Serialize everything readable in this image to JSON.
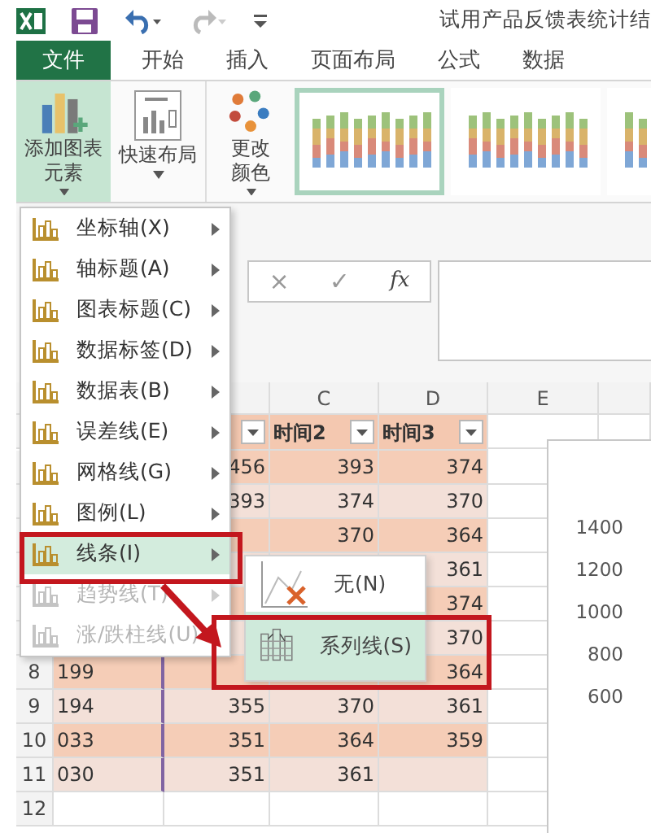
{
  "title_bar": {
    "title": "试用产品反馈表统计结"
  },
  "ribbon_tabs": [
    {
      "label": "文件",
      "kind": "file"
    },
    {
      "label": "开始",
      "kind": "tab"
    },
    {
      "label": "插入",
      "kind": "tab"
    },
    {
      "label": "页面布局",
      "kind": "tab"
    },
    {
      "label": "公式",
      "kind": "tab"
    },
    {
      "label": "数据",
      "kind": "tab"
    }
  ],
  "ribbon_buttons": [
    {
      "label": "添加图表元素",
      "kind": "add",
      "selected": true
    },
    {
      "label": "快速布局",
      "kind": "layout",
      "selected": false
    },
    {
      "label": "更改颜色",
      "kind": "colors",
      "selected": false
    }
  ],
  "chart_styles": [
    {
      "selected": true
    },
    {
      "selected": false
    },
    {
      "selected": false
    }
  ],
  "formula_bar": {
    "cancel": "×",
    "enter": "✓",
    "function": "fx"
  },
  "column_headers": [
    "C",
    "D",
    "E"
  ],
  "header_row": [
    {
      "filter": true
    },
    {
      "text": "时间2",
      "filter": true
    },
    {
      "text": "时间3",
      "filter": true
    }
  ],
  "rows": [
    {
      "b": "456",
      "c": "393",
      "d": "374"
    },
    {
      "b": "393",
      "c": "374",
      "d": "370"
    },
    {
      "c": "370",
      "d": "364"
    },
    {
      "d": "361"
    },
    {
      "d": "374"
    },
    {
      "d": "370"
    },
    {
      "number": "8",
      "a": "199",
      "d": "364"
    },
    {
      "number": "9",
      "a": "194",
      "b": "355",
      "c": "370",
      "d": "361"
    },
    {
      "number": "10",
      "a": "033",
      "b": "351",
      "c": "364",
      "d": "359"
    },
    {
      "number": "11",
      "a": "030",
      "b": "351",
      "c": "361"
    },
    {
      "number": "12"
    }
  ],
  "chart_axis_labels": [
    "1400",
    "1200",
    "1000",
    "800",
    "600"
  ],
  "menu": [
    {
      "label": "坐标轴(X)",
      "selected": false,
      "disabled": false,
      "submenu": true
    },
    {
      "label": "轴标题(A)",
      "selected": false,
      "disabled": false,
      "submenu": true
    },
    {
      "label": "图表标题(C)",
      "selected": false,
      "disabled": false,
      "submenu": true
    },
    {
      "label": "数据标签(D)",
      "selected": false,
      "disabled": false,
      "submenu": true
    },
    {
      "label": "数据表(B)",
      "selected": false,
      "disabled": false,
      "submenu": true
    },
    {
      "label": "误差线(E)",
      "selected": false,
      "disabled": false,
      "submenu": true
    },
    {
      "label": "网格线(G)",
      "selected": false,
      "disabled": false,
      "submenu": true
    },
    {
      "label": "图例(L)",
      "selected": false,
      "disabled": false,
      "submenu": true
    },
    {
      "label": "线条(I)",
      "selected": true,
      "disabled": false,
      "submenu": true
    },
    {
      "label": "趋势线(T)",
      "selected": false,
      "disabled": true,
      "submenu": true
    },
    {
      "label": "涨/跌柱线(U)",
      "selected": false,
      "disabled": true,
      "submenu": false
    }
  ],
  "submenu": [
    {
      "label": "无(N)",
      "kind": "none",
      "selected": false
    },
    {
      "label": "系列线(S)",
      "kind": "series",
      "selected": true
    }
  ]
}
